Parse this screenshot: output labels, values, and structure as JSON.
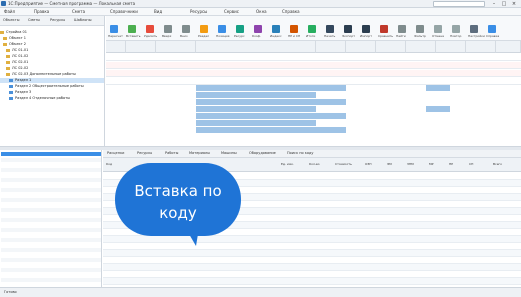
{
  "window": {
    "title": "1C:Предприятие — Сметная программа — Локальная смета",
    "search_placeholder": "Поиск"
  },
  "menu": [
    "Файл",
    "Правка",
    "Смета",
    "Справочники",
    "Вид",
    "Ресурсы",
    "Сервис",
    "Окна",
    "Справка"
  ],
  "left_tabs": [
    "Объекты",
    "Сметы",
    "Ресурсы",
    "Шаблоны"
  ],
  "tree": [
    "Стройка 01",
    "Объект 1",
    "Объект 2",
    "ЛС 01-01",
    "ЛС 01-02",
    "ЛС 02-01",
    "ЛС 02-02",
    "ЛС 02-03 Дополнительные работы",
    "Раздел 1",
    "Раздел 2 Общестроительные работы",
    "Раздел 3",
    "Раздел 4 Отделочные работы"
  ],
  "toolbar": [
    "Пересчет",
    "Вставить",
    "Удалить",
    "Вверх",
    "Вниз",
    "Раздел",
    "Позиция",
    "Ресурс",
    "Коэф.",
    "Индекс",
    "НР и СП",
    "Итоги",
    "Печать",
    "Экспорт",
    "Импорт",
    "Сравнить",
    "Найти",
    "Фильтр",
    "Отмена",
    "Повтор",
    "Настройки",
    "Справка"
  ],
  "bottom_tabs": [
    "Расценки",
    "Ресурсы",
    "Работы",
    "Материалы",
    "Машины",
    "Оборудование",
    "Поиск по коду"
  ],
  "bottom_columns": [
    "Код",
    "Наименование",
    "Ед. изм.",
    "Кол-во",
    "Стоимость",
    "ОЗП",
    "ЭМ",
    "ЗПМ",
    "МР",
    "НР",
    "СП",
    "Всего"
  ],
  "callout": {
    "line1": "Вставка по",
    "line2": "коду"
  },
  "status": "Готово"
}
